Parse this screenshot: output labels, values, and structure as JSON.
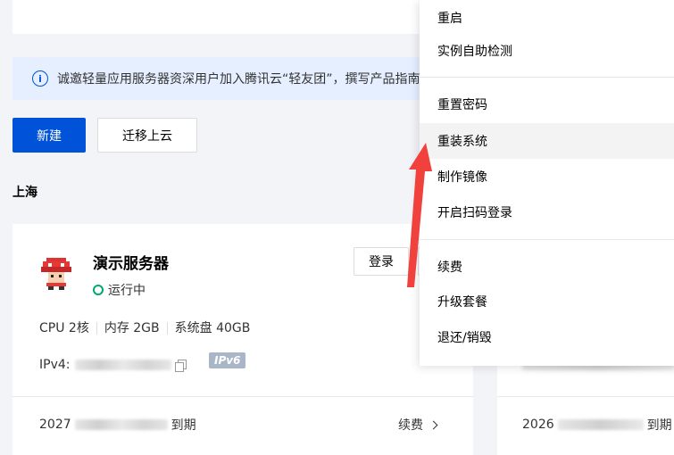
{
  "notice": {
    "text": "诚邀轻量应用服务器资深用户加入腾讯云“轻友团”，撰写产品指南"
  },
  "toolbar": {
    "new_label": "新建",
    "migrate_label": "迁移上云"
  },
  "region": {
    "name": "上海"
  },
  "instance": {
    "name": "演示服务器",
    "status": "运行中",
    "login_label": "登录",
    "specs": [
      "CPU 2核",
      "内存 2GB",
      "系统盘 40GB"
    ],
    "ipv4_label": "IPv4:",
    "ipv6_badge": "IPv6",
    "expire_prefix": "2027",
    "expire_suffix": "到期",
    "renew_label": "续费"
  },
  "instance2": {
    "expire_prefix": "2026",
    "expire_suffix": "到期"
  },
  "menu": {
    "items": [
      "重启",
      "实例自助检测",
      "重置密码",
      "重装系统",
      "制作镜像",
      "开启扫码登录",
      "续费",
      "升级套餐",
      "退还/销毁"
    ],
    "highlighted_item": "重装系统"
  },
  "colors": {
    "primary": "#0052d9",
    "running": "#00a870",
    "annotation": "#f0413c"
  },
  "icons": {
    "info": "info-circle-icon",
    "avatar": "mushroom-avatar-icon",
    "copy": "copy-icon",
    "chevron": "chevron-right-icon"
  }
}
